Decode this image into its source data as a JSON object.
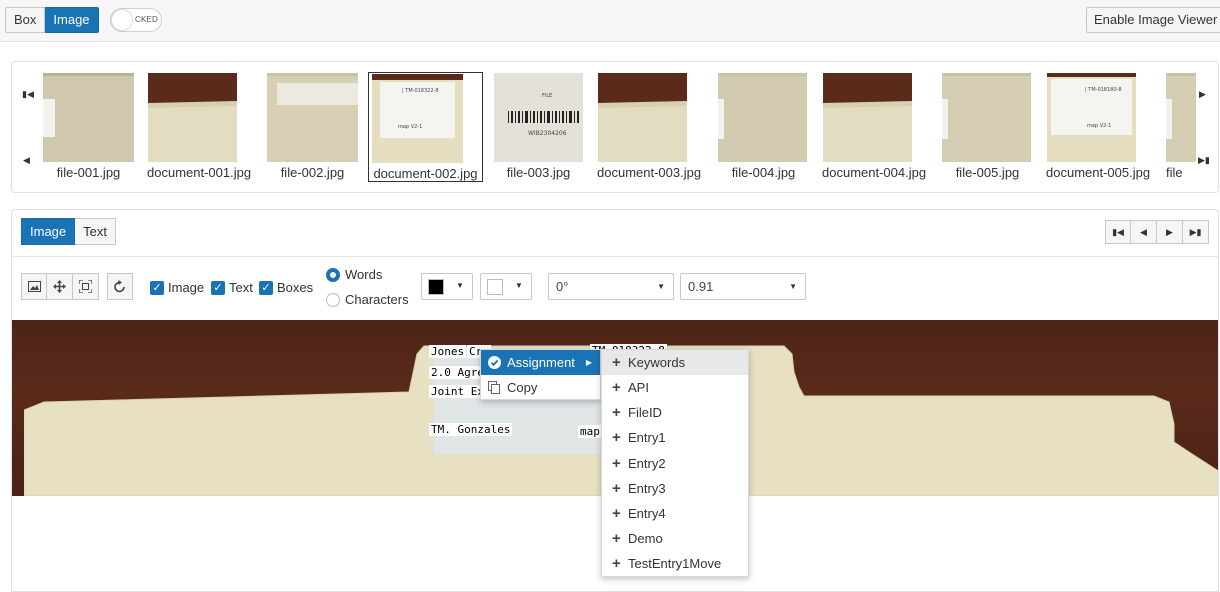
{
  "topbar": {
    "mode_buttons": [
      {
        "label": "Box",
        "active": false
      },
      {
        "label": "Image",
        "active": true
      }
    ],
    "toggle_label": "CKED",
    "enable_viewer_label": "Enable Image Viewer"
  },
  "gallery": {
    "items": [
      {
        "label": "file-001.jpg",
        "kind": "file",
        "selected": false
      },
      {
        "label": "document-001.jpg",
        "kind": "document",
        "selected": false
      },
      {
        "label": "file-002.jpg",
        "kind": "file",
        "selected": false
      },
      {
        "label": "document-002.jpg",
        "kind": "tm-label",
        "selected": true
      },
      {
        "label": "file-003.jpg",
        "kind": "barcode",
        "selected": false
      },
      {
        "label": "document-003.jpg",
        "kind": "document",
        "selected": false
      },
      {
        "label": "file-004.jpg",
        "kind": "file",
        "selected": false
      },
      {
        "label": "document-004.jpg",
        "kind": "document",
        "selected": false
      },
      {
        "label": "file-005.jpg",
        "kind": "file",
        "selected": false
      },
      {
        "label": "document-005.jpg",
        "kind": "tm-label",
        "selected": false
      },
      {
        "label": "file",
        "kind": "file",
        "selected": false
      }
    ],
    "barcode_text": "WIB2304206",
    "barcode_top": "FILE"
  },
  "panel": {
    "tabs": [
      {
        "label": "Image",
        "active": true
      },
      {
        "label": "Text",
        "active": false
      }
    ],
    "checkboxes": [
      {
        "label": "Image",
        "checked": true
      },
      {
        "label": "Text",
        "checked": true
      },
      {
        "label": "Boxes",
        "checked": true
      }
    ],
    "radios": [
      {
        "label": "Words",
        "checked": true
      },
      {
        "label": "Characters",
        "checked": false
      }
    ],
    "text_color": "#000000",
    "box_color": "#ffffff",
    "rotation": "0°",
    "zoom": "0.91"
  },
  "document": {
    "words": [
      {
        "text": "Jones",
        "id": "w1"
      },
      {
        "text": "Cru",
        "id": "w2"
      },
      {
        "text": "2.0 Agre",
        "id": "w3"
      },
      {
        "text": "Joint Exp",
        "id": "w4"
      },
      {
        "text": "TM. Gonzales",
        "id": "w5"
      },
      {
        "text": "map",
        "id": "w6"
      },
      {
        "text": "TM-018322-8",
        "id": "w7"
      }
    ]
  },
  "context_menu": {
    "items": [
      {
        "label": "Assignment",
        "has_submenu": true
      },
      {
        "label": "Copy",
        "has_submenu": false
      }
    ],
    "submenu": [
      "Keywords",
      "API",
      "FileID",
      "Entry1",
      "Entry2",
      "Entry3",
      "Entry4",
      "Demo",
      "TestEntry1Move"
    ]
  },
  "colors": {
    "accent": "#1a73b5",
    "folder": "#e7e0c3",
    "wood": "#4d2416"
  }
}
